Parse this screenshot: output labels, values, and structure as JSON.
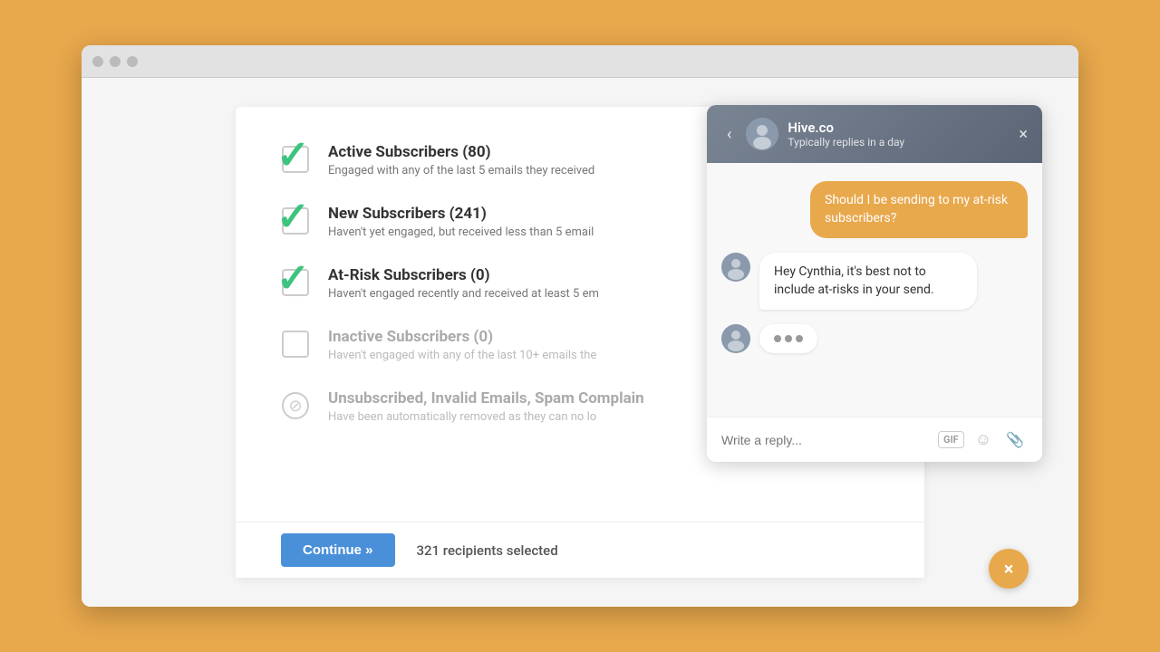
{
  "browser": {
    "dots": [
      "red-dot",
      "yellow-dot",
      "green-dot"
    ]
  },
  "subscribers": {
    "items": [
      {
        "id": "active",
        "title": "Active Subscribers (80)",
        "desc": "Engaged with any of the last 5 emails they received",
        "state": "checked",
        "active": true
      },
      {
        "id": "new",
        "title": "New Subscribers (241)",
        "desc": "Haven't yet engaged, but received less than 5 email",
        "state": "checked",
        "active": true
      },
      {
        "id": "at-risk",
        "title": "At-Risk Subscribers (0)",
        "desc": "Haven't engaged recently and received at least 5 em",
        "state": "checked",
        "active": true
      },
      {
        "id": "inactive",
        "title": "Inactive Subscribers (0)",
        "desc": "Haven't engaged with any of the last 10+ emails the",
        "state": "empty",
        "active": false
      },
      {
        "id": "unsubscribed",
        "title": "Unsubscribed, Invalid Emails, Spam Complain",
        "desc": "Have been automatically removed as they can no lo",
        "state": "disabled",
        "active": false
      }
    ]
  },
  "bottom_bar": {
    "continue_label": "Continue »",
    "recipients_text": "321 recipients selected"
  },
  "chat": {
    "header": {
      "name": "Hive.co",
      "status": "Typically replies in a day"
    },
    "messages": [
      {
        "type": "user",
        "text": "Should I be sending to my at-risk subscribers?"
      },
      {
        "type": "bot",
        "text": "Hey Cynthia, it's best not to include at-risks in your send."
      },
      {
        "type": "typing"
      }
    ],
    "input_placeholder": "Write a reply..."
  },
  "icons": {
    "back": "‹",
    "close": "×",
    "gif": "GIF",
    "emoji": "☺",
    "attach": "🔗",
    "float_x": "×"
  }
}
